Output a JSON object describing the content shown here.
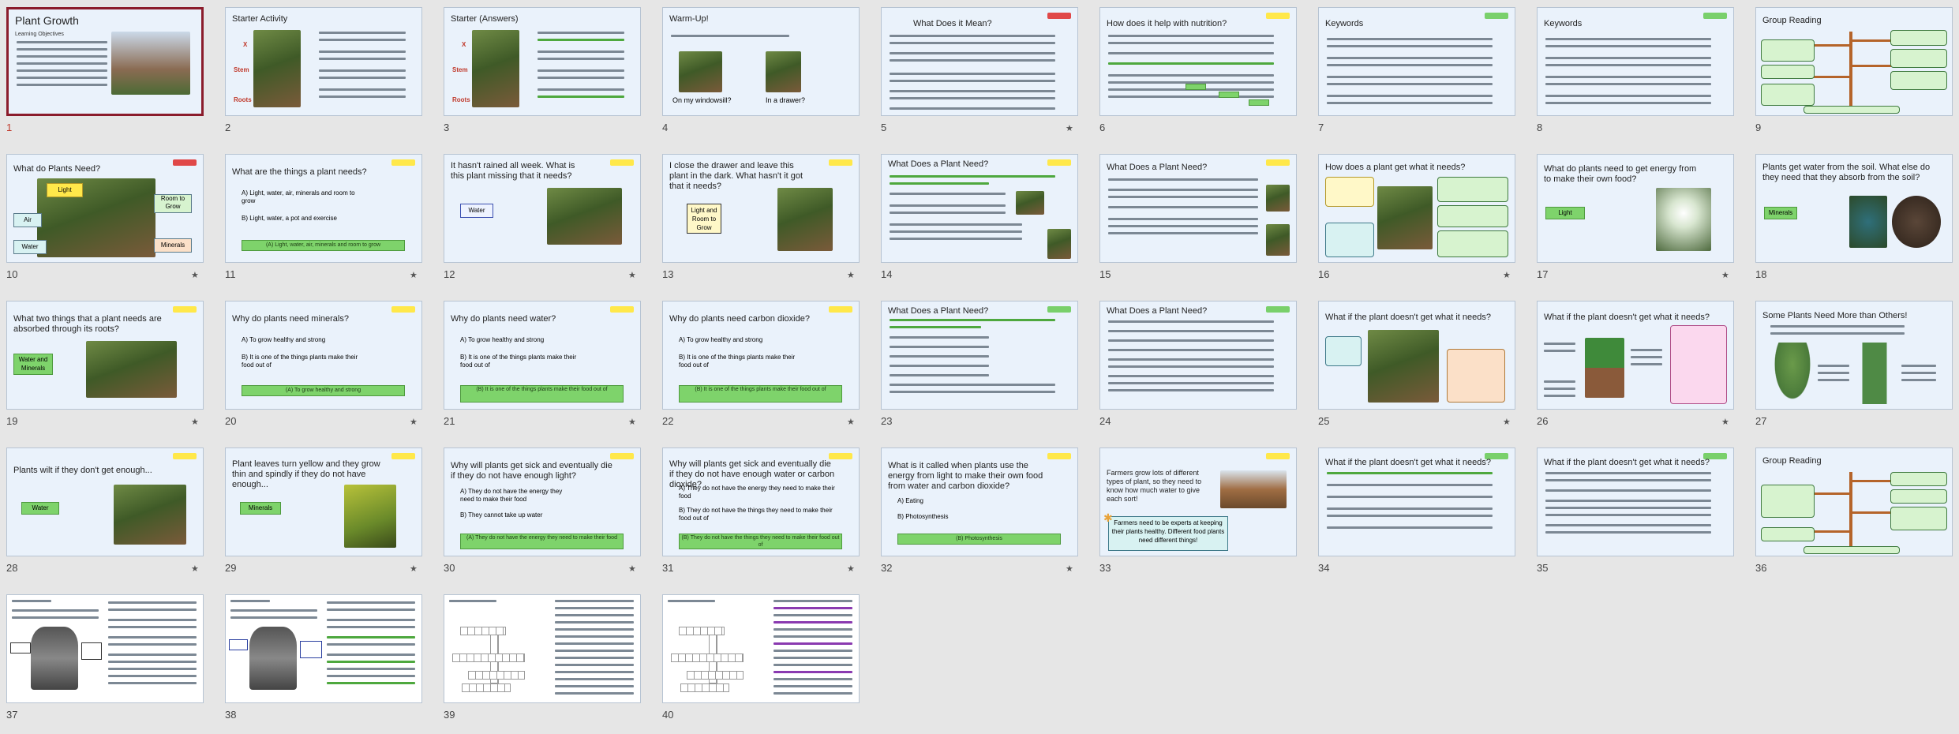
{
  "colors": {
    "selected_border": "#8b1c2b",
    "slide_bg": "#eaf2fb",
    "answer_green": "#7ed36b",
    "badge_red": "#e04848",
    "badge_yellow": "#ffe84a",
    "badge_green": "#79d06b"
  },
  "slides": [
    {
      "num": "1",
      "title": "Plant Growth",
      "sub": "Learning Objectives"
    },
    {
      "num": "2",
      "title": "Starter Activity",
      "labels": [
        "X",
        "Stem",
        "Roots"
      ]
    },
    {
      "num": "3",
      "title": "Starter (Answers)",
      "labels": [
        "X",
        "Stem",
        "Roots"
      ]
    },
    {
      "num": "4",
      "title": "Warm-Up!",
      "cap1": "On my windowsill?",
      "cap2": "In a drawer?"
    },
    {
      "num": "5",
      "title": "What Does it Mean?"
    },
    {
      "num": "6",
      "title": "How does it help with nutrition?"
    },
    {
      "num": "7",
      "title": "Keywords"
    },
    {
      "num": "8",
      "title": "Keywords"
    },
    {
      "num": "9",
      "title": "Group Reading"
    },
    {
      "num": "10",
      "title": "What do Plants Need?",
      "labels": [
        "Light",
        "Air",
        "Water",
        "Room to Grow",
        "Minerals"
      ]
    },
    {
      "num": "11",
      "title": "What are the things a plant needs?",
      "a": "A)  Light, water, air, minerals and room to grow",
      "b": "B)  Light, water, a pot and exercise",
      "ans": "(A) Light, water, air, minerals and room to grow"
    },
    {
      "num": "12",
      "title": "It hasn't rained all week. What is this plant missing that it needs?",
      "ans": "Water"
    },
    {
      "num": "13",
      "title": "I close the drawer and leave this plant in the dark. What hasn't it got that it needs?",
      "ans": "Light and Room to Grow"
    },
    {
      "num": "14",
      "title": "What Does a Plant Need?"
    },
    {
      "num": "15",
      "title": "What Does a Plant Need?"
    },
    {
      "num": "16",
      "title": "How does a plant get what it needs?"
    },
    {
      "num": "17",
      "title": "What do plants need to get energy from to make their own food?",
      "ans": "Light"
    },
    {
      "num": "18",
      "title": "Plants get water from the soil. What else do they need that they absorb from the soil?",
      "ans": "Minerals"
    },
    {
      "num": "19",
      "title": "What two things that a plant needs are absorbed through its roots?",
      "ans": "Water and Minerals"
    },
    {
      "num": "20",
      "title": "Why do plants need minerals?",
      "a": "A)  To grow healthy and strong",
      "b": "B)  It is one of the things plants make their food out of",
      "ans": "(A) To grow healthy and strong"
    },
    {
      "num": "21",
      "title": "Why do plants need water?",
      "a": "A)  To grow healthy and strong",
      "b": "B)  It is one of the things plants make their food out of",
      "ans": "(B) It is one of the things plants make their food out of"
    },
    {
      "num": "22",
      "title": "Why do plants need carbon dioxide?",
      "a": "A)  To grow healthy and strong",
      "b": "B)  It is one of the things plants make their food out of",
      "ans": "(B) It is one of the things plants make their food out of"
    },
    {
      "num": "23",
      "title": "What Does a Plant Need?"
    },
    {
      "num": "24",
      "title": "What Does a Plant Need?"
    },
    {
      "num": "25",
      "title": "What if the plant doesn't get what it needs?"
    },
    {
      "num": "26",
      "title": "What if the plant doesn't get what it needs?"
    },
    {
      "num": "27",
      "title": "Some Plants Need More than Others!"
    },
    {
      "num": "28",
      "title": "Plants wilt if they don't get enough...",
      "ans": "Water"
    },
    {
      "num": "29",
      "title": "Plant leaves turn yellow and they grow thin and spindly if they do not have enough...",
      "ans": "Minerals"
    },
    {
      "num": "30",
      "title": "Why will plants get sick and eventually die if they do not have enough light?",
      "a": "A)  They do not have the energy they need to make their food",
      "b": "B)  They cannot take up water",
      "ans": "(A) They do not have the energy they need to make their food"
    },
    {
      "num": "31",
      "title": "Why will plants get sick and eventually die if they do not have enough water or carbon dioxide?",
      "a": "A)  They do not have the energy they need to make their food",
      "b": "B)  They do not have the things they need to make their food out of",
      "ans": "(B) They do not have the things they need to make their food out of"
    },
    {
      "num": "32",
      "title": "What is it called when plants use the energy from light to make their own food from water and carbon dioxide?",
      "a": "A)  Eating",
      "b": "B)  Photosynthesis",
      "ans": "(B) Photosynthesis"
    },
    {
      "num": "33",
      "title": "Farmers grow lots of different types of plant, so they need to know how much water to give each sort!",
      "ans": "Farmers need to be experts at keeping their plants healthy. Different food plants need different things!"
    },
    {
      "num": "34",
      "title": "What if the plant doesn't get what it needs?"
    },
    {
      "num": "35",
      "title": "What if the plant doesn't get what it needs?"
    },
    {
      "num": "36",
      "title": "Group Reading"
    },
    {
      "num": "37",
      "title": ""
    },
    {
      "num": "38",
      "title": ""
    },
    {
      "num": "39",
      "title": ""
    },
    {
      "num": "40",
      "title": ""
    }
  ]
}
